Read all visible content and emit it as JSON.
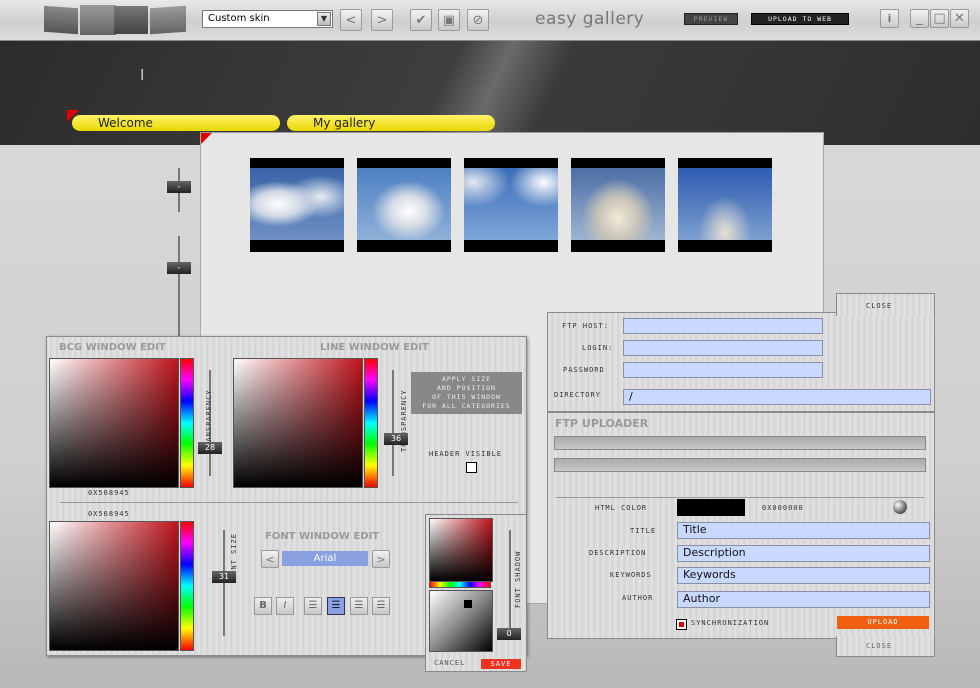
{
  "toolbar": {
    "skin_select": "Custom skin",
    "app_title": "easy gallery",
    "preview_label": "PREVIEW",
    "upload_web_label": "UPLOAD TO WEB"
  },
  "tabs": [
    {
      "label": "Welcome"
    },
    {
      "label": "My gallery"
    }
  ],
  "gallery": {
    "thumbs": [
      {
        "sky": "#3a64a8"
      },
      {
        "sky": "#4d7fc2"
      },
      {
        "sky": "#3b6db8"
      },
      {
        "sky": "#4c6ea6"
      },
      {
        "sky": "#2e5cb0"
      }
    ]
  },
  "bcg_panel": {
    "title": "BCG WINDOW EDIT",
    "line_title": "LINE WINDOW EDIT",
    "transparency_label": "TRANSPARENCY",
    "bcg_transparency": "28",
    "line_transparency": "36",
    "bcg_color_hex": "0X568945",
    "line_color_hex": "0X568945",
    "apply_text": "APPLY SIZE\nAND POSITION\nOF THIS WINDOW\nFOR ALL CATEGORIES",
    "header_visible_label": "HEADER VISIBLE",
    "font_title": "FONT WINDOW EDIT",
    "font_size_label": "FONT SIZE",
    "font_size": "31",
    "font_name": "Arial",
    "font_shadow_label": "FONT SHADOW",
    "font_shadow": "0",
    "cancel_label": "CANCEL",
    "save_label": "SAVE",
    "bold_label": "B",
    "italic_label": "I"
  },
  "ftp": {
    "close_label": "CLOSE",
    "host_label": "FTP HOST:",
    "login_label": "LOGIN:",
    "password_label": "PASSWORD",
    "directory_label": "DIRECTORY",
    "directory_value": "/",
    "host_value": "",
    "login_value": "",
    "password_value": ""
  },
  "uploader": {
    "title": "FTP UPLOADER",
    "html_color_label": "HTML COLOR",
    "html_color_hex": "0X000000",
    "title_label": "TITLE",
    "title_value": "Title",
    "description_label": "DESCRIPTION",
    "description_value": "Description",
    "keywords_label": "KEYWORDS",
    "keywords_value": "Keywords",
    "author_label": "AUTHOR",
    "author_value": "Author",
    "sync_label": "SYNCHRONIZATION",
    "upload_label": "UPLOAD",
    "close_label": "CLOSE"
  }
}
